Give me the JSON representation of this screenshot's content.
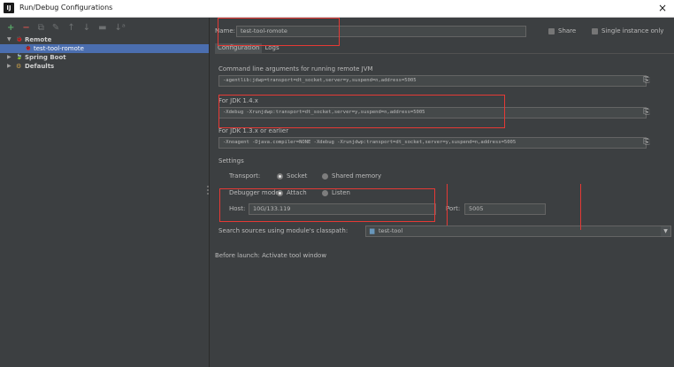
{
  "window": {
    "title": "Run/Debug Configurations",
    "logo_text": "IJ",
    "close_glyph": "×"
  },
  "toolbar": {
    "add": "+",
    "remove": "−",
    "copy": "⧉",
    "edit_defaults": "✎",
    "move_up": "↑",
    "move_down": "↓",
    "folder": "▬",
    "sort": "↓ᵃ"
  },
  "tree": {
    "remote": {
      "label": "Remote",
      "arrow": "▼",
      "icon": "🐞"
    },
    "remote_child": {
      "label": "test-tool-romote",
      "icon": "🐞"
    },
    "spring_boot": {
      "label": "Spring Boot",
      "arrow": "▶",
      "icon": "🍃"
    },
    "defaults": {
      "label": "Defaults",
      "arrow": "▶",
      "icon": "⚙"
    }
  },
  "header": {
    "name_label": "Name:",
    "name_value": "test-tool-romote",
    "share_label": "Share",
    "single_instance_label": "Single instance only"
  },
  "tabs": [
    {
      "label": "Configuration"
    },
    {
      "label": "Logs"
    }
  ],
  "config": {
    "cmd_label": "Command line arguments for running remote JVM",
    "cmd_value": "-agentlib:jdwp=transport=dt_socket,server=y,suspend=n,address=5005",
    "jdk14_label": "For JDK 1.4.x",
    "jdk14_value": "-Xdebug -Xrunjdwp:transport=dt_socket,server=y,suspend=n,address=5005",
    "jdk13_label": "For JDK 1.3.x or earlier",
    "jdk13_value": "-Xnoagent -Djava.compiler=NONE -Xdebug -Xrunjdwp:transport=dt_socket,server=y,suspend=n,address=5005",
    "settings_label": "Settings",
    "transport_label": "Transport:",
    "socket_label": "Socket",
    "shared_memory_label": "Shared memory",
    "debugger_mode_label": "Debugger mode:",
    "attach_label": "Attach",
    "listen_label": "Listen",
    "host_label": "Host:",
    "host_value": "10G/133.119",
    "port_label": "Port:",
    "port_value": "5005",
    "module_label": "Search sources using module's classpath:",
    "module_value": "test-tool",
    "before_launch": "Before launch: Activate tool window"
  },
  "colors": {
    "accent": "#4b6eaf",
    "annotation": "#e53935",
    "background": "#3c3f41"
  }
}
